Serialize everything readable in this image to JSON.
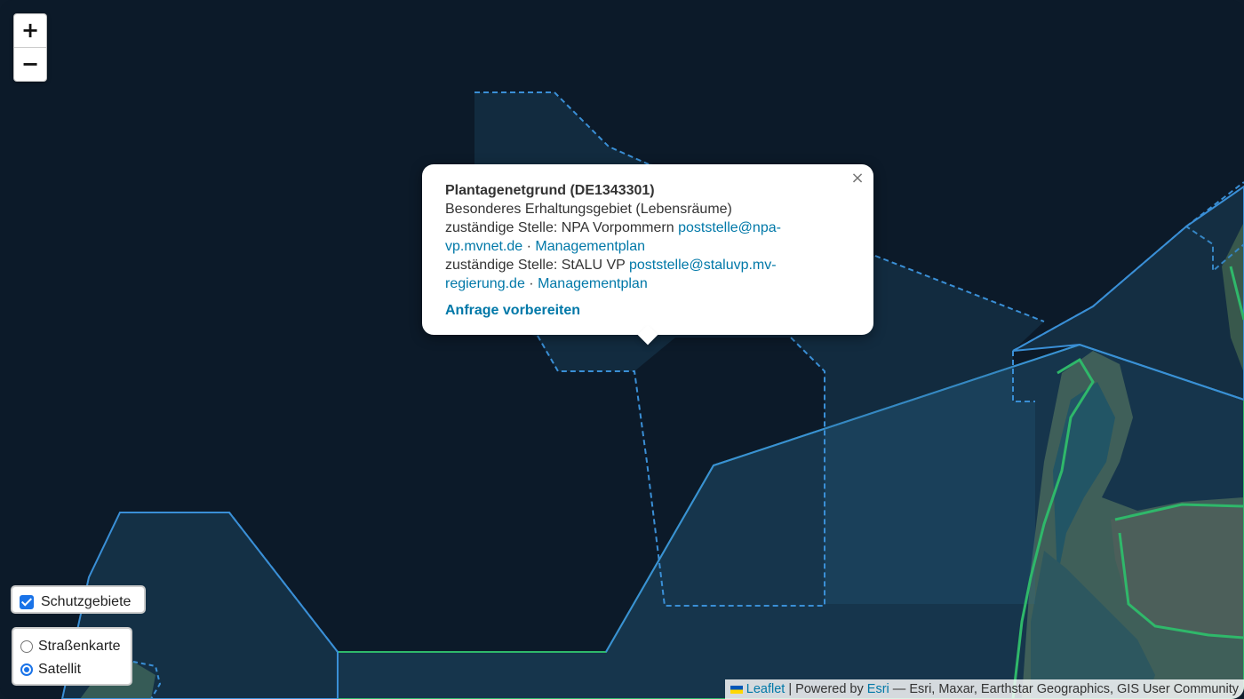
{
  "map": {
    "basemap": "satellite",
    "zoom_in_label": "+",
    "zoom_out_label": "−"
  },
  "popup": {
    "title": "Plantagenetgrund (DE1343301)",
    "subtitle": "Besonderes Erhaltungsgebiet (Lebensräume)",
    "authority_1": {
      "prefix": "zuständige Stelle: NPA Vorpommern",
      "email_line1": "poststelle@npa-",
      "email_line2": "vp.mvnet.de",
      "separator": "·",
      "plan_link": "Managementplan"
    },
    "authority_2": {
      "prefix": "zuständige Stelle: StALU VP",
      "email_line1": "poststelle@staluvp.mv-",
      "email_line2": "regierung.de",
      "separator": "·",
      "plan_link": "Managementplan"
    },
    "action_label": "Anfrage vorbereiten",
    "close_label": "×"
  },
  "overlays": {
    "schutzgebiete_label": "Schutzgebiete",
    "schutzgebiete_checked": true
  },
  "baselayers": {
    "options": [
      {
        "label": "Straßenkarte",
        "selected": false
      },
      {
        "label": "Satellit",
        "selected": true
      }
    ]
  },
  "attribution": {
    "leaflet": "Leaflet",
    "sep": "|",
    "powered_by": "Powered by",
    "esri_link": "Esri",
    "sources": "— Esri, Maxar, Earthstar Geographics, GIS User Community"
  },
  "colors": {
    "sea": "#0c1a29",
    "protected_fill": "#2a6a8f",
    "protected_stroke": "#3a8fd6",
    "green_stroke": "#2fb86a",
    "link": "#0078a8"
  }
}
